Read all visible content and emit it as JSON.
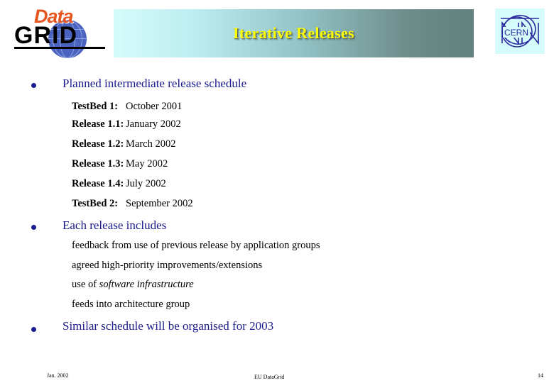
{
  "header": {
    "title": "Iterative Releases",
    "title_color": "#ffff00",
    "banner_gradient_from": "#d6fbfb",
    "banner_gradient_to": "#62807d",
    "logo_datagrid": {
      "word_data": "Data",
      "word_grid": "GRID",
      "data_color": "#e8541e",
      "grid_color": "#000000",
      "globe_color": "#4a63c0"
    },
    "logo_cern": {
      "label": "CERN",
      "color": "#2b2b9e",
      "background": "#d6fbfb"
    }
  },
  "body": {
    "bullet_color": "#1a1a8c",
    "bullets": [
      {
        "label": "Planned intermediate release schedule"
      },
      {
        "label": "Each release includes"
      },
      {
        "label": "Similar schedule will be organised for 2003"
      }
    ],
    "schedule": [
      {
        "name": "TestBed 1:",
        "date": "October 2001"
      },
      {
        "name": "Release 1.1:",
        "date": "January 2002"
      },
      {
        "name": "Release 1.2:",
        "date": "March 2002"
      },
      {
        "name": "Release 1.3:",
        "date": "May 2002"
      },
      {
        "name": "Release 1.4:",
        "date": "July 2002"
      },
      {
        "name": "TestBed 2:",
        "date": "September 2002"
      }
    ],
    "includes": [
      {
        "text": "feedback from use of previous release by application groups",
        "italic": ""
      },
      {
        "text": "agreed high-priority improvements/extensions",
        "italic": ""
      },
      {
        "text": "use of ",
        "italic": "software infrastructure"
      },
      {
        "text": "feeds into architecture group",
        "italic": ""
      }
    ]
  },
  "footer": {
    "date": "Jan. 2002",
    "organisation": "EU DataGrid",
    "page_number": "14"
  }
}
